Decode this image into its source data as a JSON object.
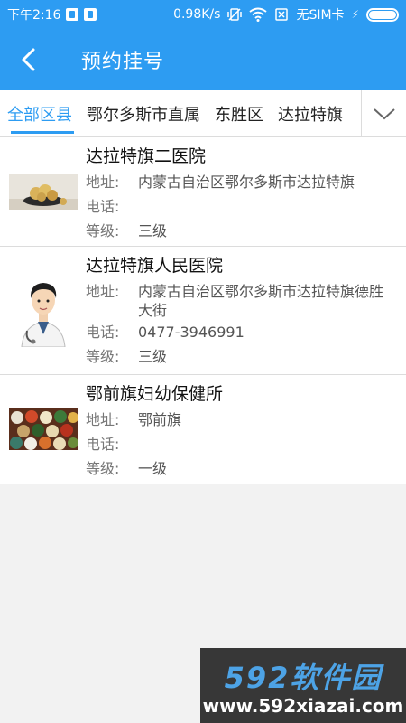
{
  "status_bar": {
    "time": "下午2:16",
    "speed": "0.98K/s",
    "sim": "无SIM卡",
    "battery_level": 1.0
  },
  "app_bar": {
    "title": "预约挂号",
    "back_icon": "chevron-left-icon"
  },
  "tabs": {
    "items": [
      "全部区县",
      "鄂尔多斯市直属",
      "东胜区",
      "达拉特旗"
    ],
    "active_index": 0,
    "more_icon": "chevron-down-icon"
  },
  "labels": {
    "address": "地址:",
    "phone": "电话:",
    "level": "等级:"
  },
  "hospitals": [
    {
      "name": "达拉特旗二医院",
      "address": "内蒙古自治区鄂尔多斯市达拉特旗",
      "phone": "",
      "level": "三级",
      "image": "fruit-bowl-image"
    },
    {
      "name": "达拉特旗人民医院",
      "address": "内蒙古自治区鄂尔多斯市达拉特旗德胜大街",
      "phone": "0477-3946991",
      "level": "三级",
      "image": "doctor-image"
    },
    {
      "name": "鄂前旗妇幼保健所",
      "address": "鄂前旗",
      "phone": "",
      "level": "一级",
      "image": "food-bowls-image"
    }
  ],
  "watermark": {
    "brand": "592软件园",
    "url": "www.592xiazai.com"
  },
  "colors": {
    "primary": "#2d9cf2"
  }
}
